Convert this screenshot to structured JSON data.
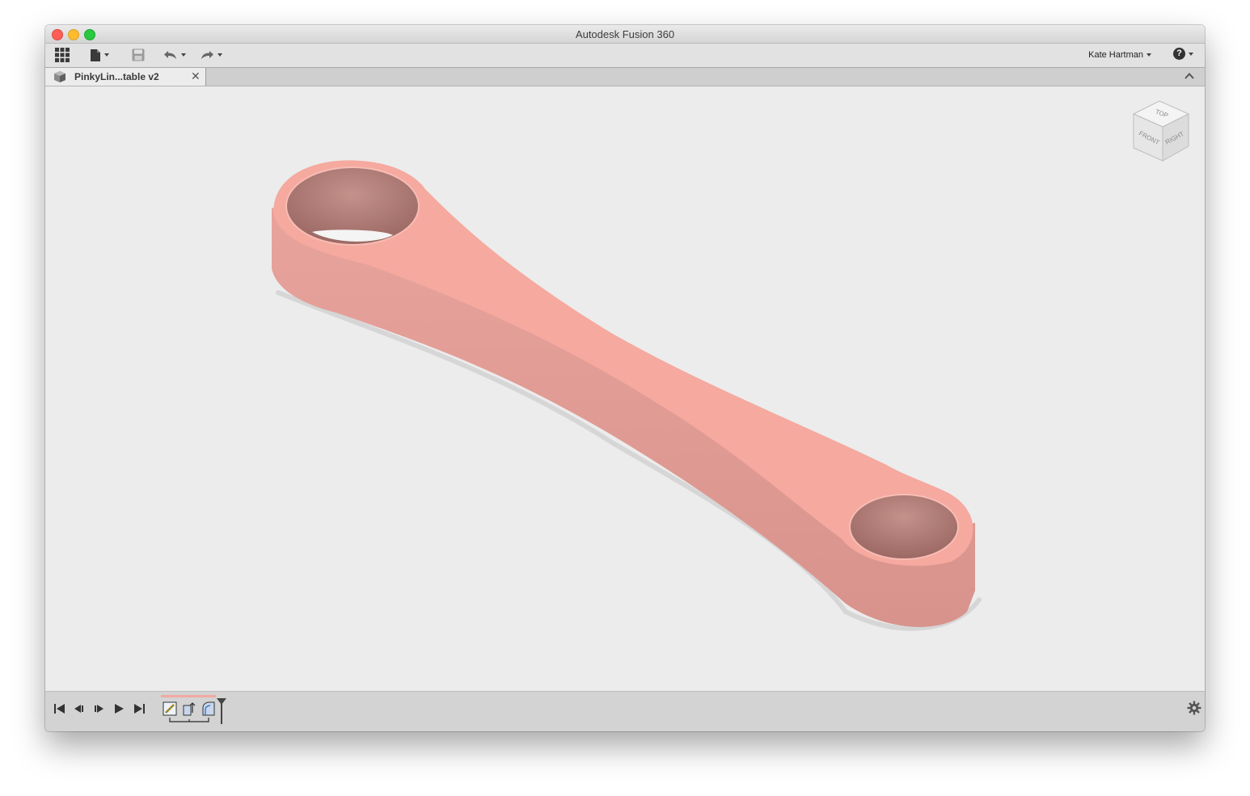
{
  "window": {
    "title": "Autodesk Fusion 360"
  },
  "toolbar": {
    "icons": [
      "app-grid-icon",
      "file-icon",
      "save-icon",
      "undo-icon",
      "redo-icon"
    ],
    "user_name": "Kate Hartman",
    "help_label": "?"
  },
  "tabs": [
    {
      "label": "PinkyLin...table v2",
      "close": "✕"
    }
  ],
  "viewcube": {
    "top": "TOP",
    "front": "FRONT",
    "right": "RIGHT"
  },
  "model": {
    "color": "#f5a99f",
    "shade": "#e29a93"
  },
  "timeline": {
    "playback": [
      "first",
      "previous",
      "next",
      "play",
      "last"
    ],
    "features": [
      "sketch-feature-icon",
      "extrude-feature-icon",
      "fillet-feature-icon"
    ]
  }
}
